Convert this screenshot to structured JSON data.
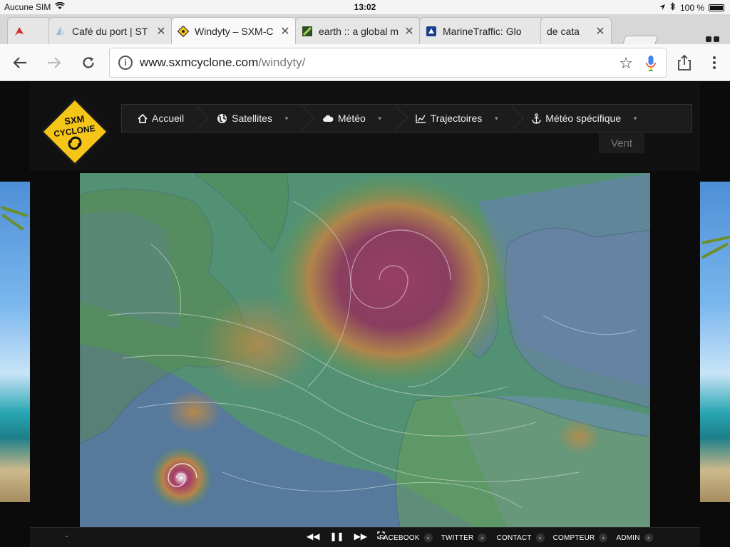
{
  "status_bar": {
    "carrier": "Aucune SIM",
    "time": "13:02",
    "battery": "100 %"
  },
  "tabs": [
    {
      "title": "",
      "favicon": "red-flag-icon"
    },
    {
      "title": "Café du port | ST",
      "favicon": "sail-icon"
    },
    {
      "title": "Windyty – SXM-C",
      "favicon": "cyclone-sign-icon",
      "active": true
    },
    {
      "title": "earth :: a global m",
      "favicon": "earth-leaf-icon"
    },
    {
      "title": "MarineTraffic: Glo",
      "favicon": "marinetraffic-icon"
    },
    {
      "title": "de cata",
      "favicon": ""
    }
  ],
  "omnibox": {
    "domain": "www.sxmcyclone.com",
    "path": "/windyty/"
  },
  "logo": {
    "line1": "SXM",
    "line2": "CYCLONE"
  },
  "nav": [
    {
      "label": "Accueil",
      "icon": "home-icon"
    },
    {
      "label": "Satellites",
      "icon": "globe-icon"
    },
    {
      "label": "Météo",
      "icon": "cloud-icon"
    },
    {
      "label": "Trajectoires",
      "icon": "chart-icon"
    },
    {
      "label": "Météo spécifique",
      "icon": "anchor-icon"
    }
  ],
  "overlay_label": "Vent",
  "bottom_bar": {
    "left_text": "-",
    "links": [
      "FACEBOOK",
      "TWITTER",
      "CONTACT",
      "COMPTEUR",
      "ADMIN"
    ]
  },
  "colors": {
    "accent_yellow": "#f5c518",
    "wind_high": "#8e3c5c",
    "wind_mid": "#b88a4a",
    "wind_low": "#4f9a4a",
    "sea_calm": "#5a6fae"
  }
}
